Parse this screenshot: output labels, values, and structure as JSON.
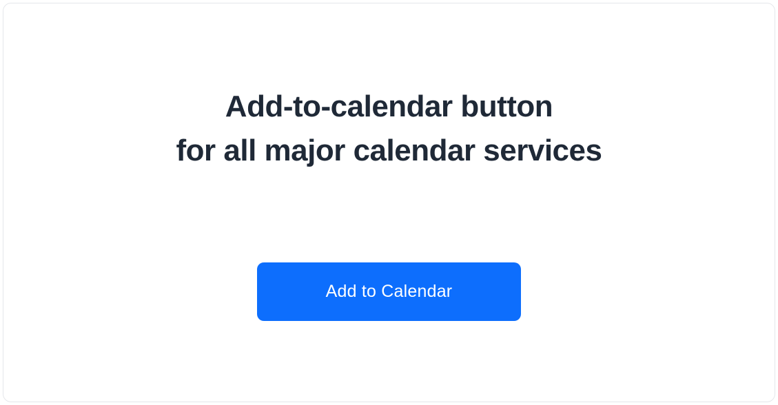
{
  "heading": {
    "line1": "Add-to-calendar button",
    "line2": "for all major calendar services"
  },
  "button": {
    "label": "Add to Calendar"
  }
}
